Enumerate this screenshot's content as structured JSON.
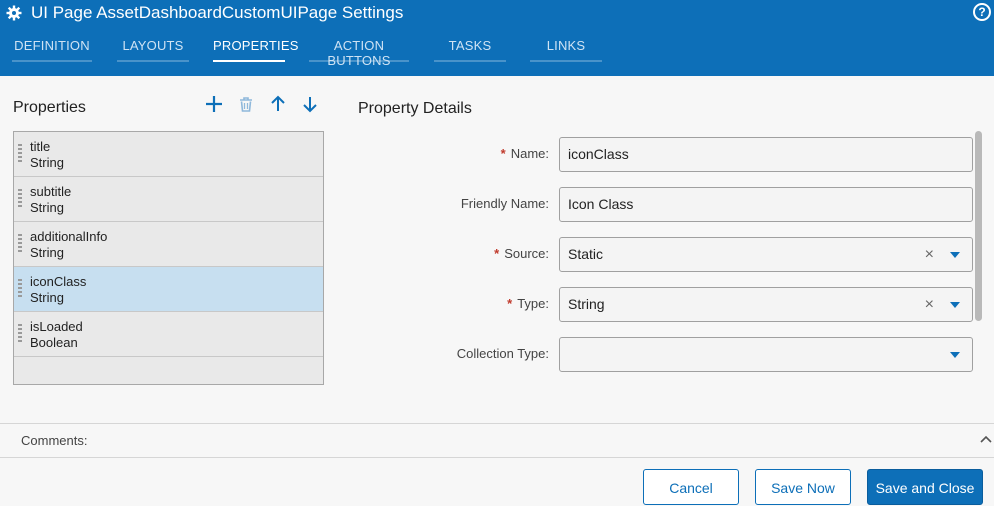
{
  "window": {
    "title": "UI Page AssetDashboardCustomUIPage Settings",
    "help_icon": "?"
  },
  "tabs": [
    {
      "label": "DEFINITION",
      "active": false
    },
    {
      "label": "LAYOUTS",
      "active": false
    },
    {
      "label": "PROPERTIES",
      "active": true
    },
    {
      "label": "ACTION BUTTONS",
      "active": false
    },
    {
      "label": "TASKS",
      "active": false
    },
    {
      "label": "LINKS",
      "active": false
    }
  ],
  "properties_panel": {
    "title": "Properties",
    "toolbar_icons": [
      "plus-icon",
      "trash-icon",
      "arrow-up-icon",
      "arrow-down-icon"
    ],
    "items": [
      {
        "name": "title",
        "type": "String",
        "selected": false
      },
      {
        "name": "subtitle",
        "type": "String",
        "selected": false
      },
      {
        "name": "additionalInfo",
        "type": "String",
        "selected": false
      },
      {
        "name": "iconClass",
        "type": "String",
        "selected": true
      },
      {
        "name": "isLoaded",
        "type": "Boolean",
        "selected": false
      }
    ]
  },
  "details_panel": {
    "title": "Property Details",
    "fields": {
      "name": {
        "label": "Name:",
        "required": "*",
        "value": "iconClass"
      },
      "friendly_name": {
        "label": "Friendly Name:",
        "value": "Icon Class"
      },
      "source": {
        "label": "Source:",
        "required": "*",
        "value": "Static",
        "clear": "×"
      },
      "type": {
        "label": "Type:",
        "required": "*",
        "value": "String",
        "clear": "×"
      },
      "collection_type": {
        "label": "Collection Type:",
        "value": ""
      }
    }
  },
  "comments": {
    "label": "Comments:"
  },
  "footer": {
    "cancel_label": "Cancel",
    "save_now_label": "Save Now",
    "save_close_label": "Save and Close"
  },
  "colors": {
    "brand": "#0d6fb8",
    "selected_row": "#c7dff0",
    "required": "#c0392b"
  }
}
